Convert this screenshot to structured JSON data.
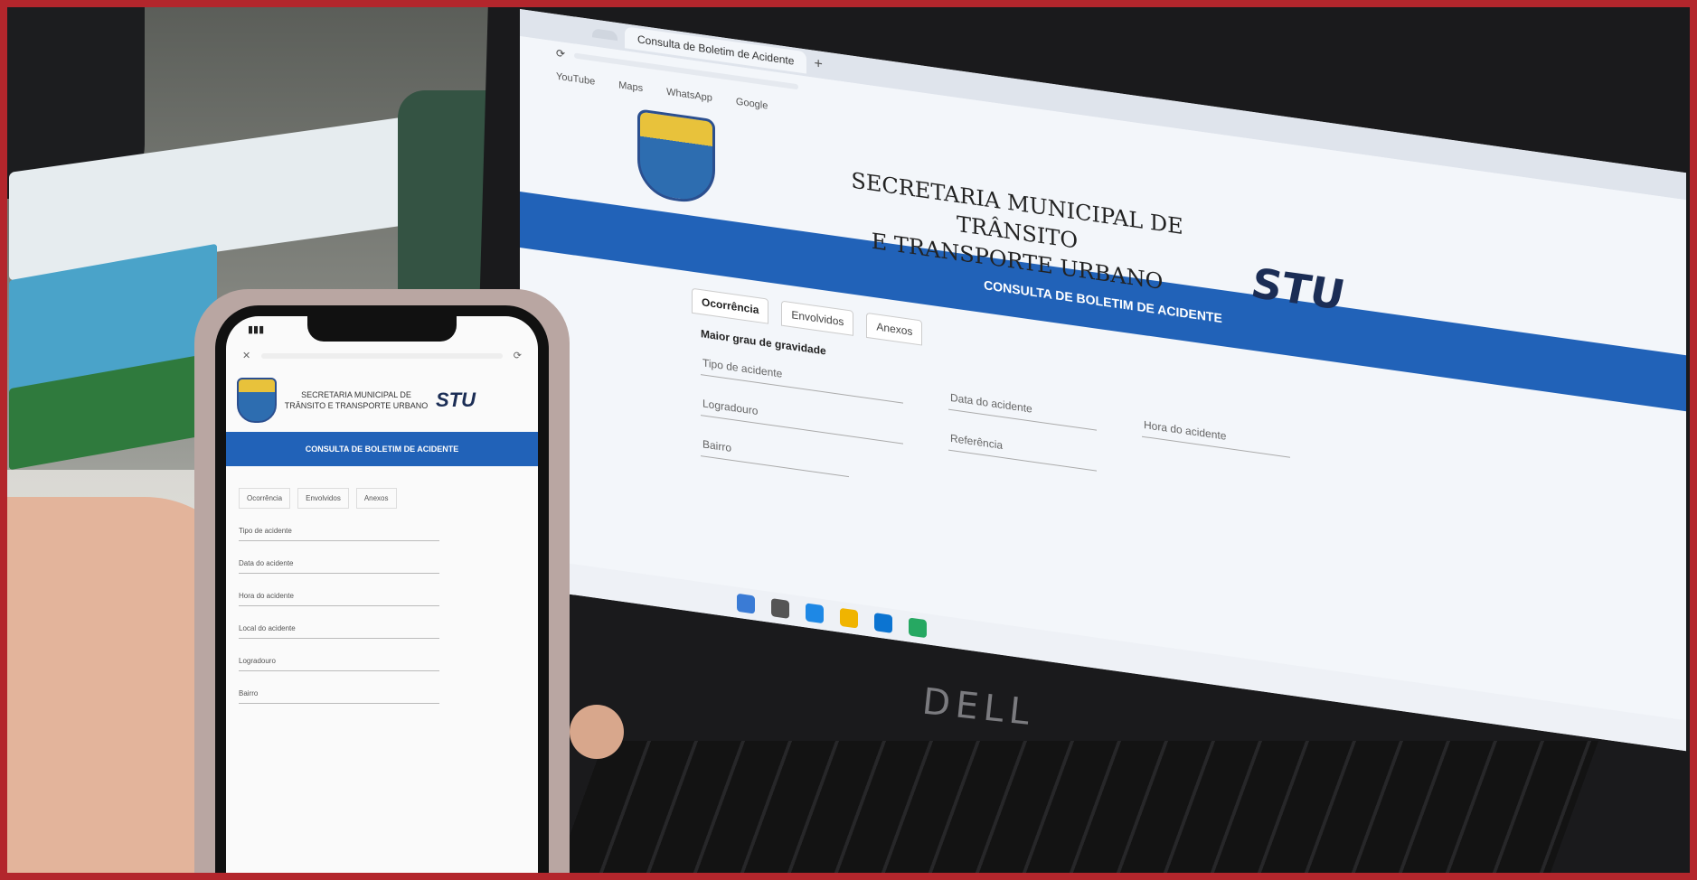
{
  "laptop": {
    "browser": {
      "tab_active": "Consulta de Boletim de Acidente",
      "tab_inactive": "",
      "url": "",
      "bookmarks": [
        "YouTube",
        "Maps",
        "WhatsApp",
        "Google"
      ]
    },
    "site": {
      "title_line1": "SECRETARIA MUNICIPAL DE TRÂNSITO",
      "title_line2": "E TRANSPORTE URBANO",
      "logo_text": "STU",
      "banner": "CONSULTA DE BOLETIM DE ACIDENTE",
      "tabs": [
        "Ocorrência",
        "Envolvidos",
        "Anexos"
      ],
      "section_title": "Maior grau de gravidade",
      "fields": [
        "Tipo de acidente",
        "Data do acidente",
        "Hora do acidente",
        "Logradouro",
        "Referência",
        "Bairro"
      ]
    },
    "brand": "DELL"
  },
  "phone": {
    "site": {
      "title": "SECRETARIA MUNICIPAL DE TRÂNSITO E TRANSPORTE URBANO",
      "logo_text": "STU",
      "banner": "CONSULTA DE BOLETIM DE ACIDENTE",
      "tabs": [
        "Ocorrência",
        "Envolvidos",
        "Anexos"
      ],
      "fields": [
        "Tipo de acidente",
        "Data do acidente",
        "Hora do acidente",
        "Local do acidente",
        "Logradouro",
        "Bairro"
      ]
    }
  },
  "colors": {
    "frame": "#b3262c",
    "band": "#2162b8",
    "logo": "#1b2d55"
  }
}
